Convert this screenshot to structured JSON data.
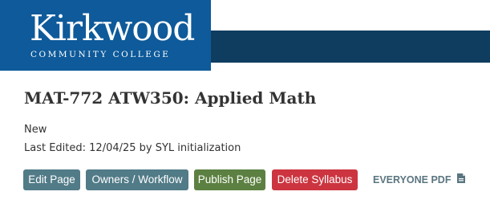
{
  "header": {
    "logo": {
      "name": "Kirkwood",
      "subtitle": "COMMUNITY COLLEGE"
    },
    "colors": {
      "band": "#0e3d60",
      "logo_background": "#0e5a9a"
    }
  },
  "page": {
    "title": "MAT-772 ATW350: Applied Math",
    "status": "New",
    "last_edited": "Last Edited: 12/04/25 by SYL initialization"
  },
  "actions": {
    "edit_label": "Edit Page",
    "owners_label": "Owners / Workflow",
    "publish_label": "Publish Page",
    "delete_label": "Delete Syllabus",
    "pdf_label": "EVERYONE PDF",
    "pdf_icon": "pdf-file-icon",
    "colors": {
      "edit": "#517b87",
      "owners": "#517b87",
      "publish": "#5c8041",
      "delete": "#cc3540",
      "pdf_link": "#5a7580"
    }
  }
}
